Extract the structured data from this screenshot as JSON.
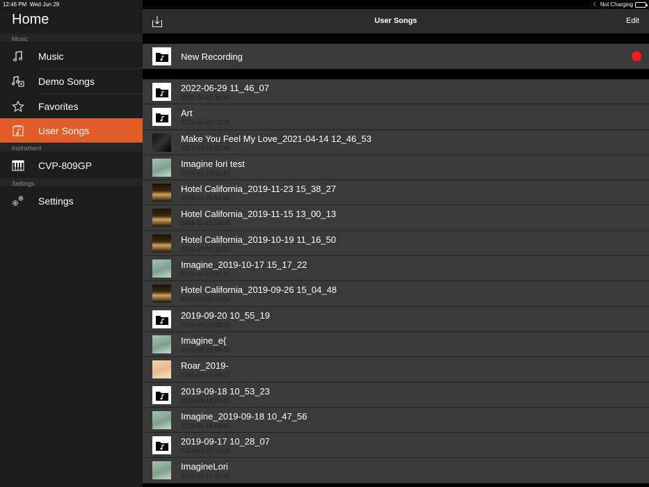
{
  "status": {
    "time": "12:46 PM",
    "date": "Wed Jun 29",
    "battery_text": "Not Charging",
    "battery_level": 0.9
  },
  "sidebar": {
    "title": "Home",
    "sections": {
      "music": "Music",
      "instrument": "Instrument",
      "settings": "Settings"
    },
    "items": [
      {
        "label": "Music",
        "icon": "music-note-icon"
      },
      {
        "label": "Demo Songs",
        "icon": "demo-songs-icon"
      },
      {
        "label": "Favorites",
        "icon": "star-icon"
      },
      {
        "label": "User Songs",
        "icon": "user-songs-icon",
        "active": true
      },
      {
        "label": "CVP-809GP",
        "icon": "piano-icon"
      },
      {
        "label": "Settings",
        "icon": "gear-icon"
      }
    ],
    "accent_color": "#e35d2a"
  },
  "header": {
    "title": "User Songs",
    "edit_label": "Edit",
    "download_icon": "download-icon"
  },
  "recording": {
    "label": "New Recording",
    "record_icon": "record-dot-icon",
    "record_color": "#ff1a1a"
  },
  "songs": [
    {
      "name": "2022-06-29 11_46_07",
      "date": "2022-06-29 11:46",
      "thumb": "folder"
    },
    {
      "name": "Art",
      "date": "2022-06-27 13:08",
      "thumb": "folder"
    },
    {
      "name": "Make You Feel My Love_2021-04-14 12_46_53",
      "date": "2021-04-14 12:46",
      "thumb": "dark"
    },
    {
      "name": "Imagine lori test",
      "date": "2020-01-24 11:43",
      "thumb": "green"
    },
    {
      "name": "Hotel California_2019-11-23 15_38_27",
      "date": "2019-11-23 14:38",
      "thumb": "hotel"
    },
    {
      "name": "Hotel California_2019-11-15 13_00_13",
      "date": "2019-11-15 14:00",
      "thumb": "hotel"
    },
    {
      "name": "Hotel California_2019-10-19 11_16_50",
      "date": "2019-10-19 11:16",
      "thumb": "hotel"
    },
    {
      "name": "Imagine_2019-10-17 15_17_22",
      "date": "2019-10-17 15:17",
      "thumb": "green"
    },
    {
      "name": "Hotel California_2019-09-26 15_04_48",
      "date": "2019-09-26 13:04",
      "thumb": "hotel"
    },
    {
      "name": "2019-09-20 10_55_19",
      "date": "2019-09-20 08:55",
      "thumb": "folder"
    },
    {
      "name": "Imagine_e{",
      "date": "2019-09-20 08:41",
      "thumb": "green"
    },
    {
      "name": "Roar_2019-",
      "date": "2019-09-18 09:17",
      "thumb": "roar"
    },
    {
      "name": "2019-09-18 10_53_23",
      "date": "2019-09-18 08:53",
      "thumb": "folder"
    },
    {
      "name": "Imagine_2019-09-18 10_47_56",
      "date": "2019-09-18 08:47",
      "thumb": "green"
    },
    {
      "name": "2019-09-17 10_28_07",
      "date": "2019-09-17 10:28",
      "thumb": "folder"
    },
    {
      "name": "ImagineLori",
      "date": "2019-09-17 10:26",
      "thumb": "green"
    }
  ]
}
